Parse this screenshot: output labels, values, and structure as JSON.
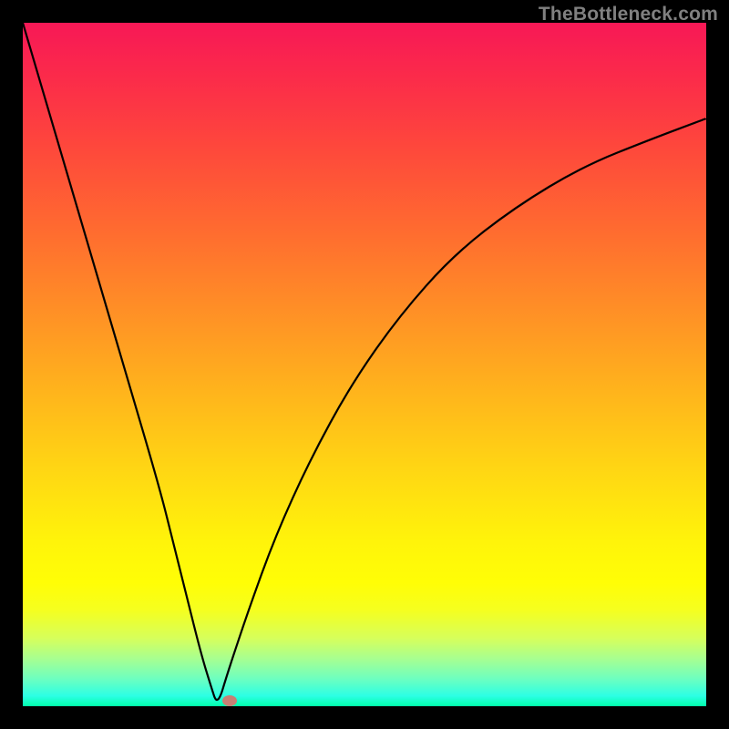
{
  "watermark": "TheBottleneck.com",
  "chart_data": {
    "type": "line",
    "title": "",
    "xlabel": "",
    "ylabel": "",
    "xlim": [
      0,
      100
    ],
    "ylim": [
      0,
      100
    ],
    "grid": false,
    "legend": false,
    "series": [
      {
        "name": "bottleneck-curve",
        "x": [
          0,
          5,
          10,
          15,
          20,
          22,
          24,
          26,
          27.5,
          28.5,
          30,
          33,
          37,
          42,
          48,
          55,
          63,
          72,
          82,
          92,
          100
        ],
        "values": [
          100,
          83,
          66,
          49,
          32,
          24,
          16,
          8,
          3,
          0,
          5,
          14,
          25,
          36,
          47,
          57,
          66,
          73,
          79,
          83,
          86
        ]
      }
    ],
    "marker": {
      "x": 30.2,
      "y": 0.8,
      "color": "#c78075"
    },
    "gradient_stops": [
      {
        "pos": 0,
        "color": "#f71856"
      },
      {
        "pos": 0.18,
        "color": "#fe473c"
      },
      {
        "pos": 0.42,
        "color": "#ff8f26"
      },
      {
        "pos": 0.66,
        "color": "#ffd813"
      },
      {
        "pos": 0.82,
        "color": "#fffe06"
      },
      {
        "pos": 0.93,
        "color": "#a8ff90"
      },
      {
        "pos": 1.0,
        "color": "#00ffab"
      }
    ]
  }
}
